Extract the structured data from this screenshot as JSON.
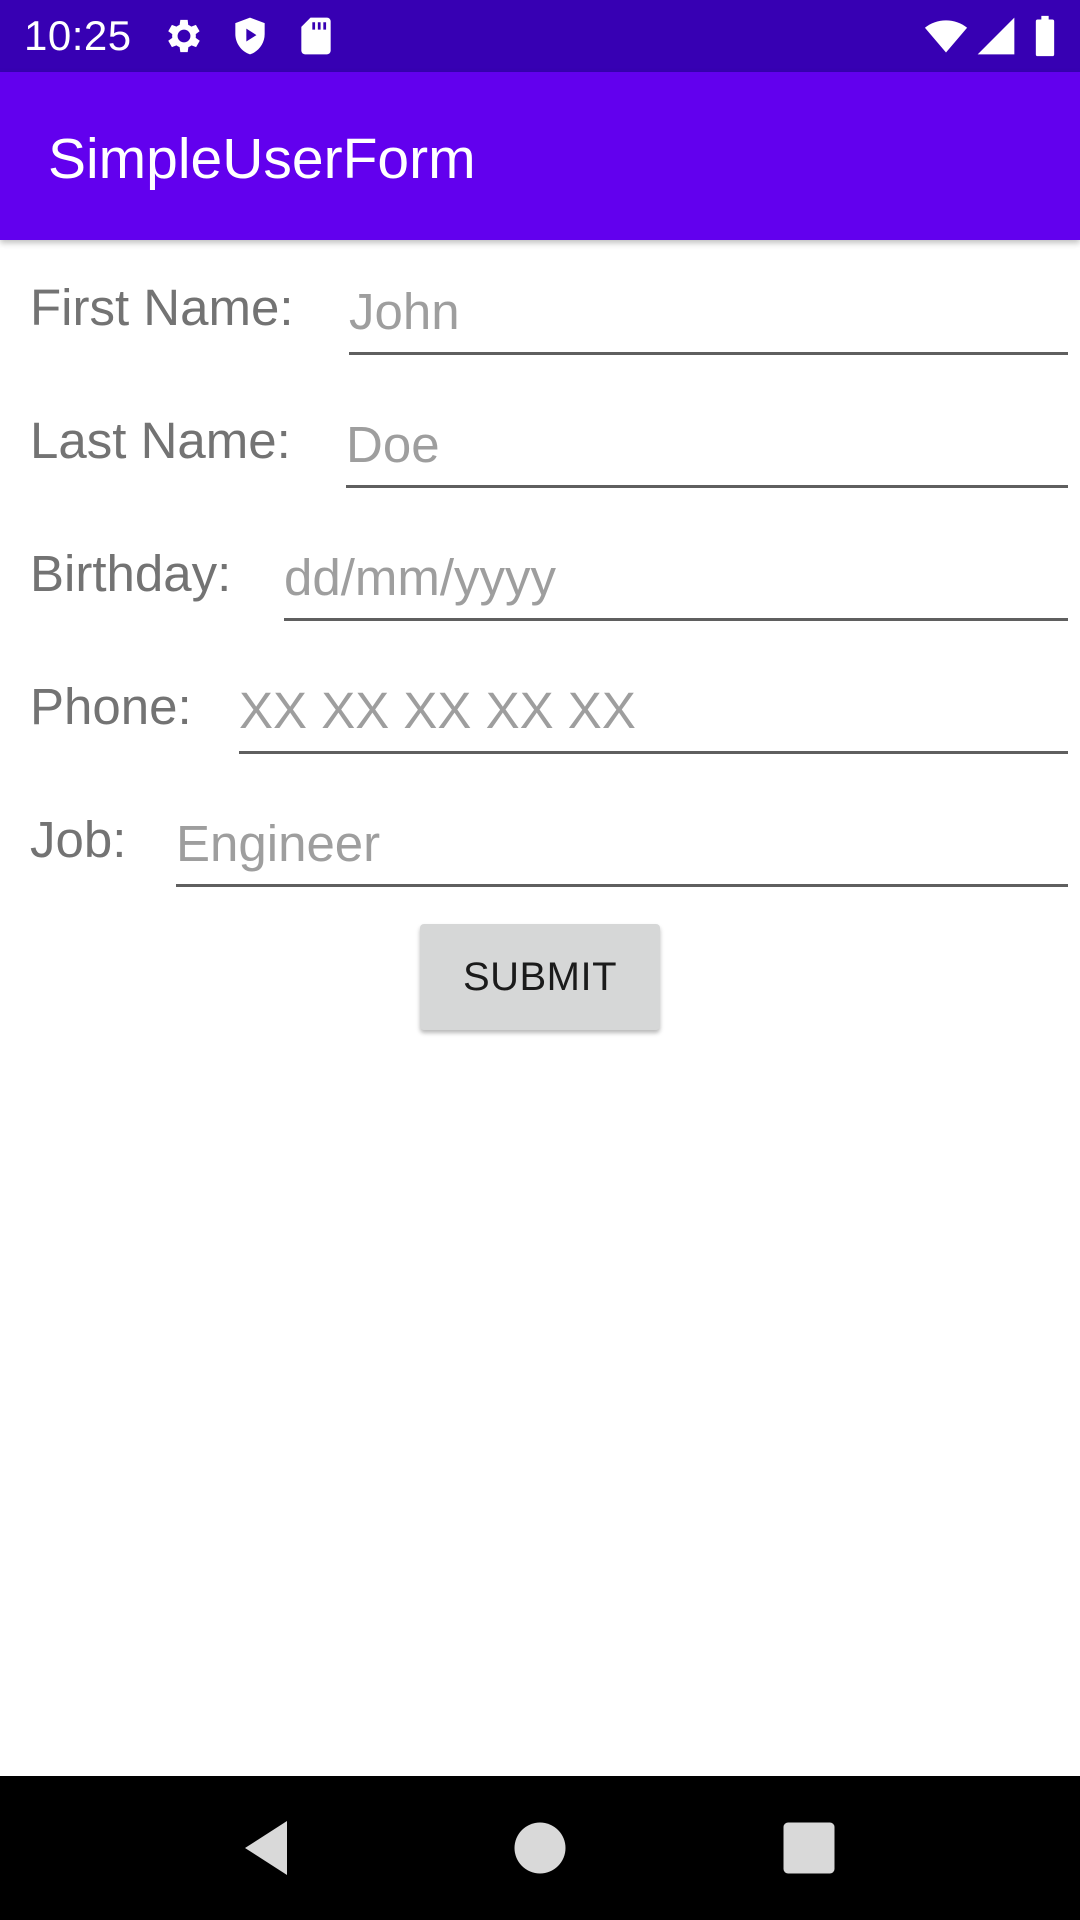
{
  "status_bar": {
    "time": "10:25",
    "background": "#3700b3",
    "icons_left": [
      "gear-icon",
      "shield-play-icon",
      "sd-card-icon"
    ],
    "icons_right": [
      "wifi-icon",
      "cell-signal-icon",
      "battery-icon"
    ]
  },
  "app_bar": {
    "title": "SimpleUserForm",
    "background": "#6200ee"
  },
  "form": {
    "fields": [
      {
        "label": "First Name:",
        "placeholder": "John",
        "value": ""
      },
      {
        "label": "Last Name:",
        "placeholder": "Doe",
        "value": ""
      },
      {
        "label": "Birthday:",
        "placeholder": "dd/mm/yyyy",
        "value": ""
      },
      {
        "label": "Phone:",
        "placeholder": "XX XX XX XX XX",
        "value": ""
      },
      {
        "label": "Job:",
        "placeholder": "Engineer",
        "value": ""
      }
    ],
    "submit_label": "SUBMIT"
  },
  "nav_bar": {
    "buttons": [
      "back-icon",
      "home-icon",
      "recents-icon"
    ]
  }
}
